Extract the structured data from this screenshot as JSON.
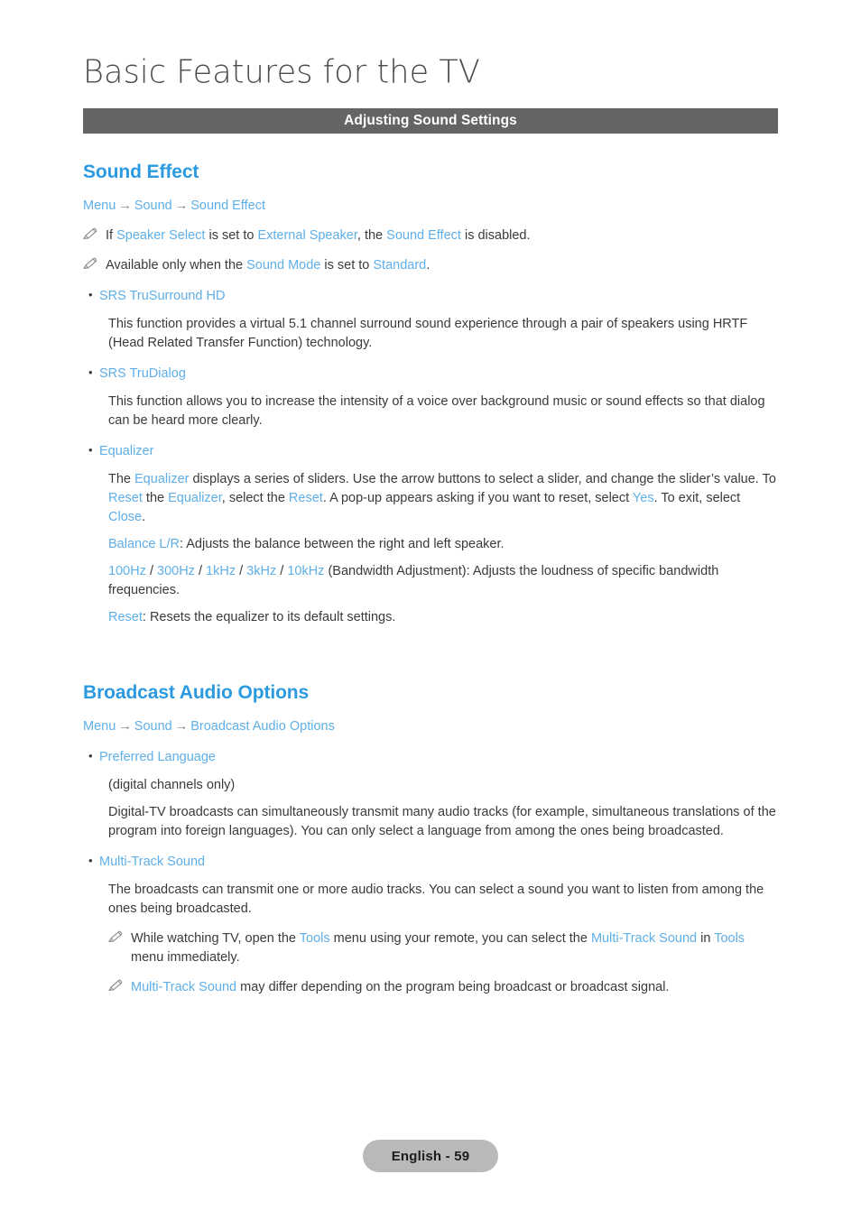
{
  "page": {
    "chapter_title": "Basic Features for the TV",
    "banner_title": "Adjusting Sound Settings",
    "footer_label": "English - 59",
    "colors": {
      "heading_blue": "#2b9ae0",
      "link_blue": "#5fafe8",
      "banner_gray": "#666363",
      "body_gray": "#3a3a3a",
      "footer_pill_gray": "#b9b9b9"
    },
    "icons": {
      "note": "pencil-icon",
      "bullet": "bullet-dot",
      "arrow": "right-arrow-icon"
    }
  },
  "sections": [
    {
      "heading": "Sound Effect",
      "breadcrumb": {
        "items": [
          "Menu",
          "Sound",
          "Sound Effect"
        ],
        "arrow": "→"
      },
      "notes": [
        {
          "parts": [
            {
              "t": "If ",
              "k": "plain"
            },
            {
              "t": "Speaker Select",
              "k": "link"
            },
            {
              "t": " is set to ",
              "k": "plain"
            },
            {
              "t": "External Speaker",
              "k": "link"
            },
            {
              "t": ", the ",
              "k": "plain"
            },
            {
              "t": "Sound Effect",
              "k": "link"
            },
            {
              "t": " is disabled.",
              "k": "plain"
            }
          ]
        },
        {
          "parts": [
            {
              "t": "Available only when the ",
              "k": "plain"
            },
            {
              "t": "Sound Mode",
              "k": "link"
            },
            {
              "t": " is set to ",
              "k": "plain"
            },
            {
              "t": "Standard",
              "k": "link"
            },
            {
              "t": ".",
              "k": "plain"
            }
          ]
        }
      ],
      "items": [
        {
          "label": "SRS TruSurround HD",
          "paragraphs": [
            {
              "parts": [
                {
                  "t": "This function provides a virtual 5.1 channel surround sound experience through a pair of speakers using HRTF (Head Related Transfer Function) technology.",
                  "k": "plain"
                }
              ]
            }
          ]
        },
        {
          "label": "SRS TruDialog",
          "paragraphs": [
            {
              "parts": [
                {
                  "t": "This function allows you to increase the intensity of a voice over background music or sound effects so that dialog can be heard more clearly.",
                  "k": "plain"
                }
              ]
            }
          ]
        },
        {
          "label": "Equalizer",
          "paragraphs": [
            {
              "parts": [
                {
                  "t": "The ",
                  "k": "plain"
                },
                {
                  "t": "Equalizer",
                  "k": "link"
                },
                {
                  "t": " displays a series of sliders. Use the arrow buttons to select a slider, and change the slider’s value. To ",
                  "k": "plain"
                },
                {
                  "t": "Reset",
                  "k": "link"
                },
                {
                  "t": " the ",
                  "k": "plain"
                },
                {
                  "t": "Equalizer",
                  "k": "link"
                },
                {
                  "t": ", select the ",
                  "k": "plain"
                },
                {
                  "t": "Reset",
                  "k": "link"
                },
                {
                  "t": ". A pop-up appears asking if you want to reset, select ",
                  "k": "plain"
                },
                {
                  "t": "Yes",
                  "k": "link"
                },
                {
                  "t": ". To exit, select ",
                  "k": "plain"
                },
                {
                  "t": "Close",
                  "k": "link"
                },
                {
                  "t": ".",
                  "k": "plain"
                }
              ]
            },
            {
              "parts": [
                {
                  "t": "Balance L/R",
                  "k": "link"
                },
                {
                  "t": ": Adjusts the balance between the right and left speaker.",
                  "k": "plain"
                }
              ]
            },
            {
              "parts": [
                {
                  "t": "100Hz",
                  "k": "link"
                },
                {
                  "t": " / ",
                  "k": "plain"
                },
                {
                  "t": "300Hz",
                  "k": "link"
                },
                {
                  "t": " / ",
                  "k": "plain"
                },
                {
                  "t": "1kHz",
                  "k": "link"
                },
                {
                  "t": " / ",
                  "k": "plain"
                },
                {
                  "t": "3kHz",
                  "k": "link"
                },
                {
                  "t": " / ",
                  "k": "plain"
                },
                {
                  "t": "10kHz",
                  "k": "link"
                },
                {
                  "t": " (Bandwidth Adjustment): Adjusts the loudness of specific bandwidth frequencies.",
                  "k": "plain"
                }
              ]
            },
            {
              "parts": [
                {
                  "t": "Reset",
                  "k": "link"
                },
                {
                  "t": ": Resets the equalizer to its default settings.",
                  "k": "plain"
                }
              ]
            }
          ]
        }
      ]
    },
    {
      "heading": "Broadcast Audio Options",
      "breadcrumb": {
        "items": [
          "Menu",
          "Sound",
          "Broadcast Audio Options"
        ],
        "arrow": "→"
      },
      "notes": [],
      "items": [
        {
          "label": "Preferred Language",
          "paragraphs": [
            {
              "parts": [
                {
                  "t": "(digital channels only)",
                  "k": "plain"
                }
              ]
            },
            {
              "parts": [
                {
                  "t": "Digital-TV broadcasts can simultaneously transmit many audio tracks (for example, simultaneous translations of the program into foreign languages). You can only select a language from among the ones being broadcasted.",
                  "k": "plain"
                }
              ]
            }
          ]
        },
        {
          "label": "Multi-Track Sound",
          "paragraphs": [
            {
              "parts": [
                {
                  "t": "The broadcasts can transmit one or more audio tracks. You can select a sound you want to listen from among the ones being broadcasted.",
                  "k": "plain"
                }
              ]
            }
          ],
          "sub_notes": [
            {
              "parts": [
                {
                  "t": "While watching TV, open the ",
                  "k": "plain"
                },
                {
                  "t": "Tools",
                  "k": "link"
                },
                {
                  "t": " menu using your remote, you can select the ",
                  "k": "plain"
                },
                {
                  "t": "Multi-Track Sound",
                  "k": "link"
                },
                {
                  "t": " in ",
                  "k": "plain"
                },
                {
                  "t": "Tools",
                  "k": "link"
                },
                {
                  "t": " menu immediately.",
                  "k": "plain"
                }
              ]
            },
            {
              "parts": [
                {
                  "t": "Multi-Track Sound",
                  "k": "link"
                },
                {
                  "t": " may differ depending on the program being broadcast or broadcast signal.",
                  "k": "plain"
                }
              ]
            }
          ]
        }
      ]
    }
  ]
}
